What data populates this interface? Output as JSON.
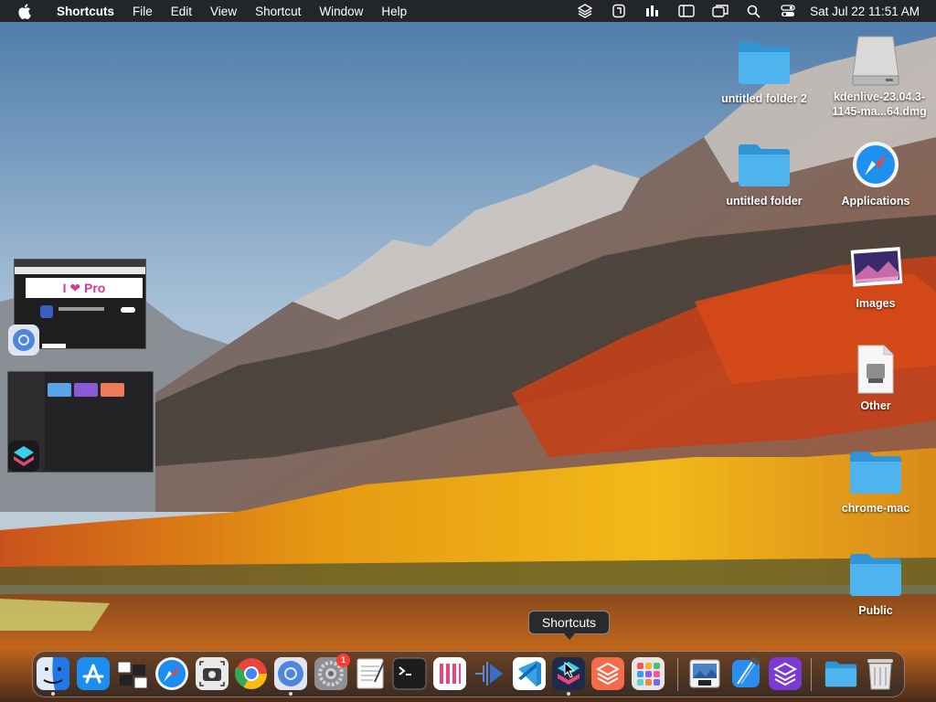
{
  "menubar": {
    "app_name": "Shortcuts",
    "menus": [
      "File",
      "Edit",
      "View",
      "Shortcut",
      "Window",
      "Help"
    ],
    "status_icons": [
      "layers-icon",
      "shortcuts-status-icon",
      "bars-icon",
      "sidebar-icon",
      "screen-mirror-icon",
      "search-icon",
      "control-center-icon"
    ],
    "clock": "Sat Jul 22  11:51 AM"
  },
  "desktop_icons": [
    {
      "label": "untitled folder 2",
      "icon": "folder-icon"
    },
    {
      "label": "kdenlive-23.04.3-1145-ma...64.dmg",
      "icon": "disk-image-icon"
    },
    {
      "label": "untitled folder",
      "icon": "folder-icon"
    },
    {
      "label": "Applications",
      "icon": "safari-icon"
    },
    {
      "label": "Images",
      "icon": "photo-icon"
    },
    {
      "label": "Other",
      "icon": "document-icon"
    },
    {
      "label": "chrome-mac",
      "icon": "folder-icon"
    },
    {
      "label": "Public",
      "icon": "folder-icon"
    }
  ],
  "thumbnails": [
    {
      "name": "browser-window",
      "text": "I ❤ Pro"
    },
    {
      "name": "shortcuts-window",
      "text": ""
    }
  ],
  "tooltip": "Shortcuts",
  "dock": {
    "items": [
      "finder-icon",
      "app-store-icon",
      "photo-booth-icon",
      "safari-icon",
      "screenshot-icon",
      "chrome-icon",
      "chromium-icon",
      "system-settings-icon",
      "textedit-icon",
      "terminal-icon",
      "columns-app-icon",
      "kdenlive-icon",
      "vscode-icon",
      "shortcuts-icon",
      "layers-app-icon",
      "launchpad-icon",
      "preview-icon",
      "xcode-icon",
      "affinity-icon",
      "downloads-folder-icon",
      "trash-icon"
    ],
    "badge_count": "1"
  },
  "colors": {
    "menubar": "#1e1e20",
    "folder": "#3aa6e8",
    "accent": "#0a84ff"
  }
}
